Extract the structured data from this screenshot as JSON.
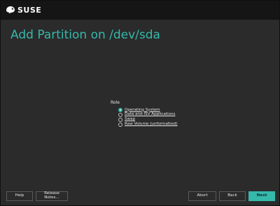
{
  "brand": {
    "logo_text": "SUSE"
  },
  "page": {
    "title": "Add Partition on /dev/sda"
  },
  "role": {
    "label": "Role",
    "options": [
      {
        "label": "Operating System",
        "checked": true
      },
      {
        "label": "Data and ISV Applications",
        "checked": false
      },
      {
        "label": "Swap",
        "checked": false
      },
      {
        "label": "Raw Volume (unformatted)",
        "checked": false
      }
    ]
  },
  "footer": {
    "help_label": "Help",
    "release_notes_label": "Release Notes...",
    "abort_label": "Abort",
    "back_label": "Back",
    "next_label": "Next"
  },
  "colors": {
    "accent": "#35b9ab",
    "background": "#2b2b2b",
    "topbar": "#151515"
  },
  "icons": {
    "logo": "chameleon-icon",
    "radio": "radio-button"
  }
}
